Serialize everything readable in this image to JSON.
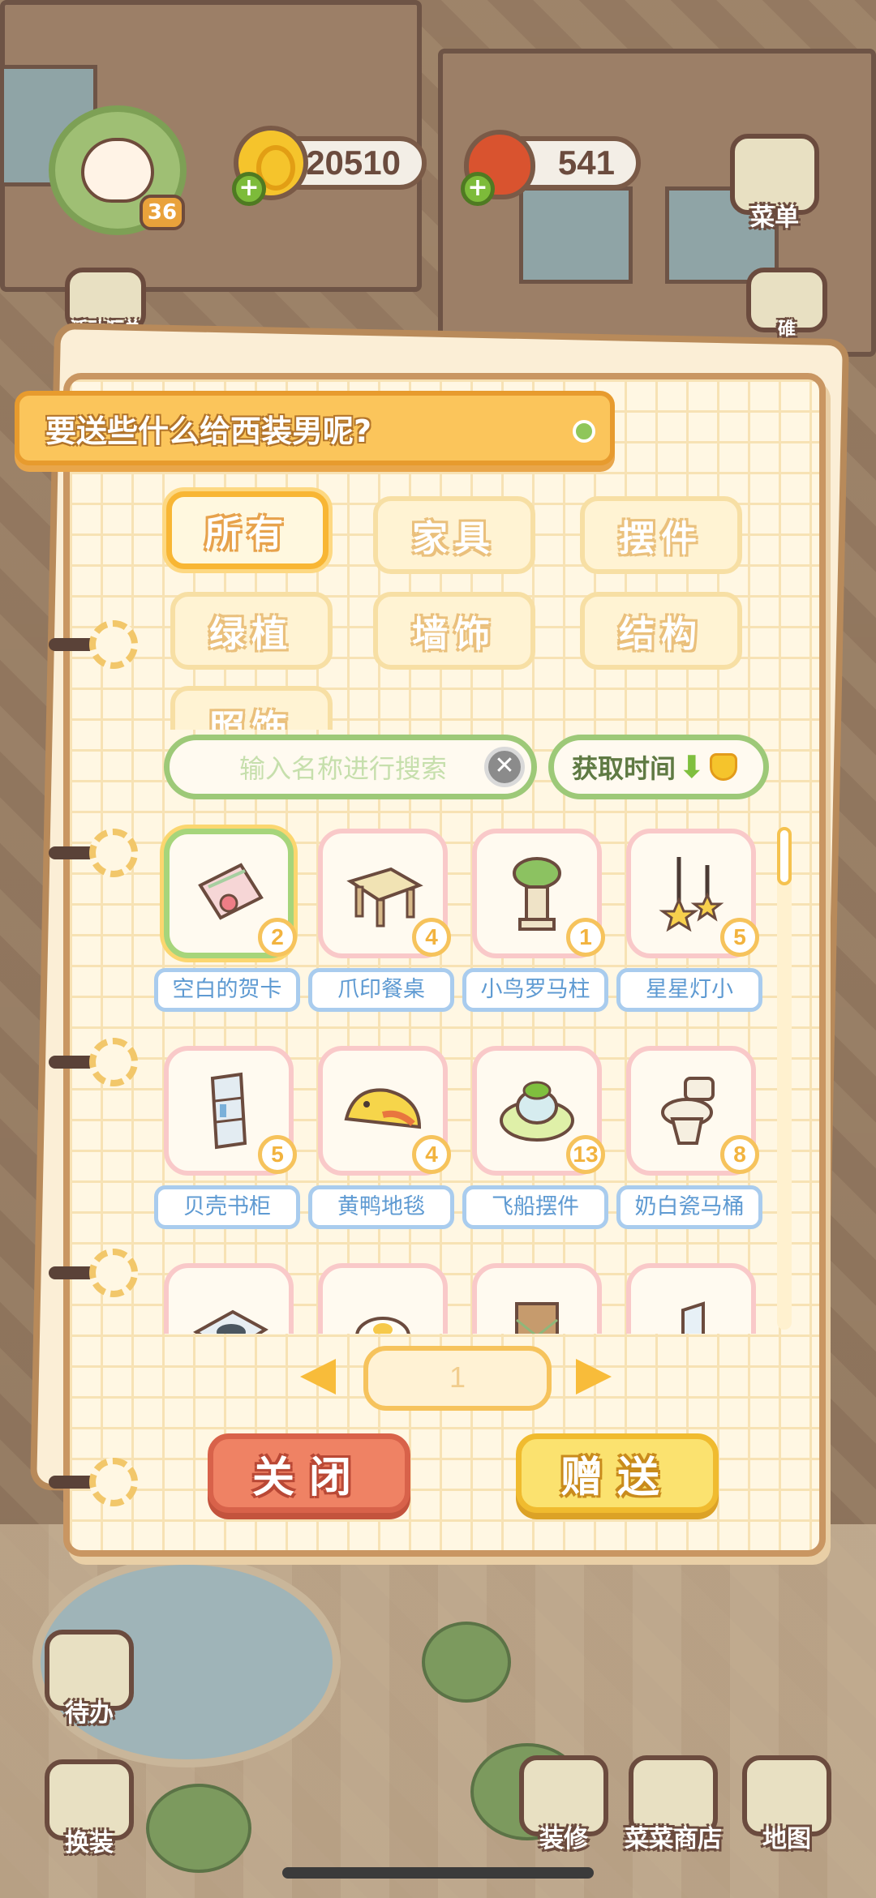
{
  "hud": {
    "level": "36",
    "coins": "20510",
    "apples": "541",
    "menu_label": "菜单",
    "activity_label": "活动汇总",
    "side_label": "碓"
  },
  "bottom_nav": {
    "todo": "待办",
    "dress": "换装",
    "decorate": "装修",
    "shop": "菜菜商店",
    "map": "地图"
  },
  "dialog": {
    "title": "要送些什么给西装男呢?",
    "categories": [
      {
        "label": "所有",
        "active": true
      },
      {
        "label": "家具",
        "active": false
      },
      {
        "label": "摆件",
        "active": false
      },
      {
        "label": "绿植",
        "active": false
      },
      {
        "label": "墙饰",
        "active": false
      },
      {
        "label": "结构",
        "active": false
      },
      {
        "label": "照饰",
        "active": false
      }
    ],
    "search": {
      "placeholder": "输入名称进行搜索",
      "clear_symbol": "✕"
    },
    "sort": {
      "label": "获取时间",
      "arrow": "⬇"
    },
    "items": [
      {
        "name": "空白的贺卡",
        "count": "2",
        "selected": true,
        "icon": "card-icon"
      },
      {
        "name": "爪印餐桌",
        "count": "4",
        "selected": false,
        "icon": "table-icon"
      },
      {
        "name": "小鸟罗马柱",
        "count": "1",
        "selected": false,
        "icon": "pillar-icon"
      },
      {
        "name": "星星灯小",
        "count": "5",
        "selected": false,
        "icon": "star-lamp-icon"
      },
      {
        "name": "贝壳书柜",
        "count": "5",
        "selected": false,
        "icon": "bookshelf-icon"
      },
      {
        "name": "黄鸭地毯",
        "count": "4",
        "selected": false,
        "icon": "rug-icon"
      },
      {
        "name": "飞船摆件",
        "count": "13",
        "selected": false,
        "icon": "ship-icon"
      },
      {
        "name": "奶白瓷马桶",
        "count": "8",
        "selected": false,
        "icon": "toilet-icon"
      },
      {
        "name": "",
        "count": "",
        "selected": false,
        "icon": "plate-icon"
      },
      {
        "name": "",
        "count": "",
        "selected": false,
        "icon": "lamp-icon"
      },
      {
        "name": "",
        "count": "",
        "selected": false,
        "icon": "fence-icon"
      },
      {
        "name": "",
        "count": "",
        "selected": false,
        "icon": "mirror-icon"
      }
    ],
    "page": "1",
    "close_label": "关闭",
    "gift_label": "赠送"
  }
}
